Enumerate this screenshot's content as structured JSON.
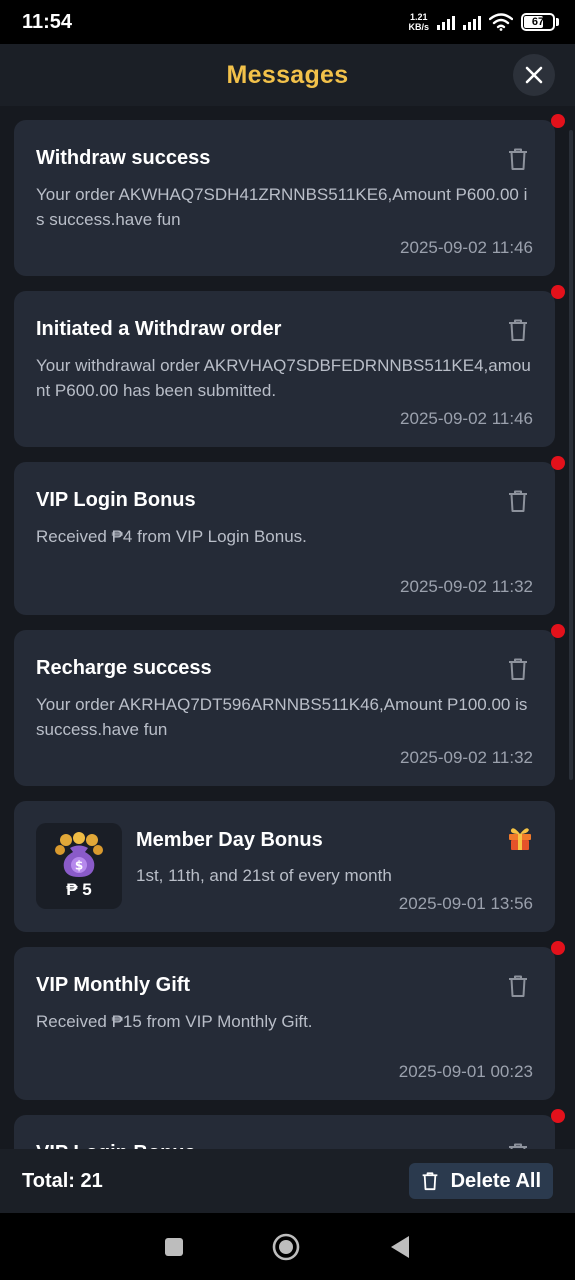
{
  "status_bar": {
    "time": "11:54",
    "net_speed_value": "1.21",
    "net_speed_unit": "KB/s",
    "battery": "67"
  },
  "header": {
    "title": "Messages"
  },
  "messages": [
    {
      "title": "Withdraw success",
      "body": "Your order AKWHAQ7SDH41ZRNNBS511KE6,Amount P600.00 is success.have fun",
      "time": "2025-09-02 11:46",
      "unread": true
    },
    {
      "title": "Initiated a Withdraw order",
      "body": "Your withdrawal order AKRVHAQ7SDBFEDRNNBS511KE4,amount P600.00 has been submitted.",
      "time": "2025-09-02 11:46",
      "unread": true
    },
    {
      "title": "VIP Login Bonus",
      "body": "Received ₱4 from VIP Login Bonus.",
      "time": "2025-09-02 11:32",
      "unread": true
    },
    {
      "title": "Recharge success",
      "body": "Your order AKRHAQ7DT596ARNNBS511K46,Amount P100.00 is success.have fun",
      "time": "2025-09-02 11:32",
      "unread": true
    }
  ],
  "promo": {
    "amount": "₱ 5",
    "title": "Member Day Bonus",
    "body": "1st, 11th, and 21st of every month",
    "time": "2025-09-01 13:56"
  },
  "messages_after": [
    {
      "title": "VIP Monthly Gift",
      "body": "Received ₱15 from VIP Monthly Gift.",
      "time": "2025-09-01 00:23",
      "unread": true
    },
    {
      "title": "VIP Login Bonus",
      "unread": true
    }
  ],
  "footer": {
    "total_label": "Total: 21",
    "delete_all_label": "Delete All"
  },
  "colors": {
    "accent": "#f2c14a",
    "unread_dot": "#e3111b",
    "card_bg": "#252b37",
    "page_bg": "#16191f"
  }
}
